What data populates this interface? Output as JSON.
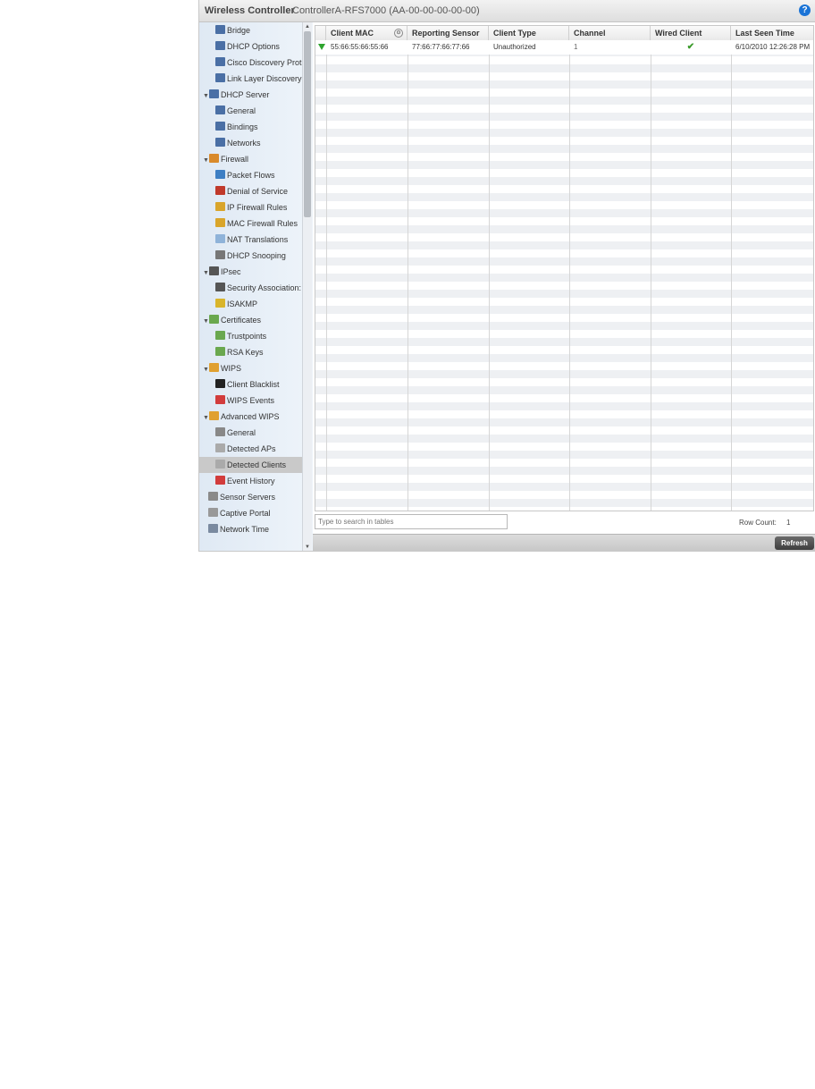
{
  "header": {
    "app_title": "Wireless Controller",
    "device": "ControllerA-RFS7000 (AA-00-00-00-00-00)",
    "help_icon": "?"
  },
  "sidebar": {
    "items": [
      {
        "label": "Bridge",
        "icon": "network-icon"
      },
      {
        "label": "DHCP Options",
        "icon": "network-icon"
      },
      {
        "label": "Cisco Discovery Prot",
        "icon": "network-icon"
      },
      {
        "label": "Link Layer Discovery",
        "icon": "network-icon"
      },
      {
        "label": "DHCP Server",
        "icon": "network-icon",
        "expander": true
      },
      {
        "label": "General",
        "icon": "network-icon"
      },
      {
        "label": "Bindings",
        "icon": "network-icon"
      },
      {
        "label": "Networks",
        "icon": "network-icon"
      },
      {
        "label": "Firewall",
        "icon": "firewall-icon",
        "expander": true
      },
      {
        "label": "Packet Flows",
        "icon": "packet-flows-icon"
      },
      {
        "label": "Denial of Service",
        "icon": "denial-of-service-icon"
      },
      {
        "label": "IP Firewall Rules",
        "icon": "firewall-rules-icon"
      },
      {
        "label": "MAC Firewall Rules",
        "icon": "firewall-rules-icon"
      },
      {
        "label": "NAT Translations",
        "icon": "nat-icon"
      },
      {
        "label": "DHCP Snooping",
        "icon": "dhcp-snooping-icon"
      },
      {
        "label": "IPsec",
        "icon": "ipsec-icon",
        "expander": true
      },
      {
        "label": "Security Association:",
        "icon": "ipsec-icon"
      },
      {
        "label": "ISAKMP",
        "icon": "key-icon"
      },
      {
        "label": "Certificates",
        "icon": "certificate-icon",
        "expander": true
      },
      {
        "label": "Trustpoints",
        "icon": "certificate-icon"
      },
      {
        "label": "RSA Keys",
        "icon": "certificate-icon"
      },
      {
        "label": "WIPS",
        "icon": "wips-icon",
        "expander": true
      },
      {
        "label": "Client Blacklist",
        "icon": "blacklist-icon"
      },
      {
        "label": "WIPS Events",
        "icon": "flag-icon"
      },
      {
        "label": "Advanced WIPS",
        "icon": "advanced-wips-icon",
        "expander": true
      },
      {
        "label": "General",
        "icon": "settings-icon"
      },
      {
        "label": "Detected APs",
        "icon": "access-point-icon"
      },
      {
        "label": "Detected Clients",
        "icon": "access-point-icon",
        "selected": true
      },
      {
        "label": "Event History",
        "icon": "flag-icon"
      },
      {
        "label": "Sensor Servers",
        "icon": "server-icon"
      },
      {
        "label": "Captive Portal",
        "icon": "portal-icon"
      },
      {
        "label": "Network Time",
        "icon": "clock-icon"
      }
    ]
  },
  "table": {
    "columns": [
      "Client MAC",
      "Reporting Sensor",
      "Client Type",
      "Channel",
      "Wired Client",
      "Last Seen Time"
    ],
    "rows": [
      {
        "client_mac": "55:66:55:66:55:66",
        "reporting_sensor": "77:66:77:66:77:66",
        "client_type": "Unauthorized",
        "channel": "1",
        "wired_client": "✔",
        "last_seen": "6/10/2010 12:26:28 PM"
      }
    ]
  },
  "search": {
    "placeholder": "Type to search in tables"
  },
  "row_count": {
    "label": "Row Count:",
    "value": "1"
  },
  "buttons": {
    "refresh": "Refresh"
  },
  "colors": {
    "accent": "#1a73d6",
    "selected": "#c9c9c9",
    "status_ok": "#2ea42e"
  }
}
